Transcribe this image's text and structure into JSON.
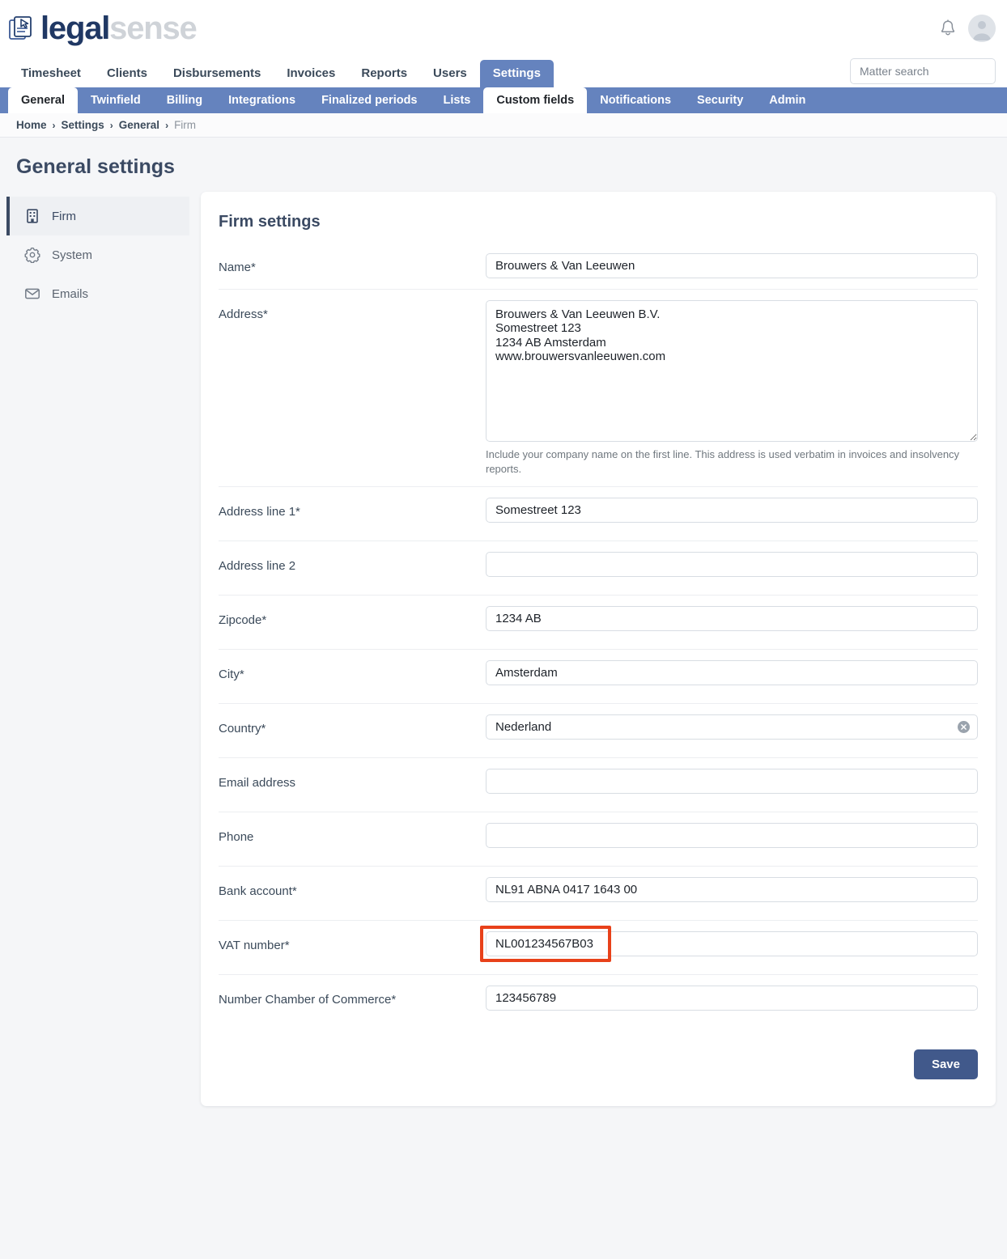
{
  "brand": {
    "logo_primary": "legal",
    "logo_secondary": "sense",
    "color_navy": "#203864",
    "color_gray": "#cfd3d8",
    "nav_blue": "#6583be",
    "accent_red": "#e8411a",
    "save_blue": "#41598b"
  },
  "header": {
    "bell_icon": "bell-icon",
    "avatar_icon": "avatar"
  },
  "search": {
    "placeholder": "Matter search",
    "value": ""
  },
  "top_nav": {
    "items": [
      {
        "label": "Timesheet",
        "active": false
      },
      {
        "label": "Clients",
        "active": false
      },
      {
        "label": "Disbursements",
        "active": false
      },
      {
        "label": "Invoices",
        "active": false
      },
      {
        "label": "Reports",
        "active": false
      },
      {
        "label": "Users",
        "active": false
      },
      {
        "label": "Settings",
        "active": true
      }
    ]
  },
  "sub_nav": {
    "items": [
      {
        "label": "General",
        "active": true
      },
      {
        "label": "Twinfield",
        "active": false
      },
      {
        "label": "Billing",
        "active": false
      },
      {
        "label": "Integrations",
        "active": false
      },
      {
        "label": "Finalized periods",
        "active": false
      },
      {
        "label": "Lists",
        "active": false
      },
      {
        "label": "Custom fields",
        "active": true
      },
      {
        "label": "Notifications",
        "active": false
      },
      {
        "label": "Security",
        "active": false
      },
      {
        "label": "Admin",
        "active": false
      }
    ]
  },
  "breadcrumb": {
    "items": [
      "Home",
      "Settings",
      "General",
      "Firm"
    ],
    "separator": "›"
  },
  "page": {
    "title": "General settings"
  },
  "sidebar": {
    "items": [
      {
        "label": "Firm",
        "icon": "building-icon",
        "active": true
      },
      {
        "label": "System",
        "icon": "gear-icon",
        "active": false
      },
      {
        "label": "Emails",
        "icon": "envelope-icon",
        "active": false
      }
    ]
  },
  "form": {
    "title": "Firm settings",
    "fields": {
      "name": {
        "label": "Name*",
        "value": "Brouwers & Van Leeuwen",
        "placeholder": ""
      },
      "address": {
        "label": "Address*",
        "value": "Brouwers & Van Leeuwen B.V.\nSomestreet 123\n1234 AB Amsterdam\nwww.brouwersvanleeuwen.com",
        "help": "Include your company name on the first line. This address is used verbatim in invoices and insolvency reports."
      },
      "address_line_1": {
        "label": "Address line 1*",
        "value": "Somestreet 123",
        "placeholder": ""
      },
      "address_line_2": {
        "label": "Address line 2",
        "value": "",
        "placeholder": ""
      },
      "zipcode": {
        "label": "Zipcode*",
        "value": "1234 AB",
        "placeholder": ""
      },
      "city": {
        "label": "City*",
        "value": "Amsterdam",
        "placeholder": ""
      },
      "country": {
        "label": "Country*",
        "value": "Nederland",
        "placeholder": "",
        "clear_icon": "clear-circle-icon"
      },
      "email_address": {
        "label": "Email address",
        "value": "",
        "placeholder": ""
      },
      "phone": {
        "label": "Phone",
        "value": "",
        "placeholder": ""
      },
      "bank_account": {
        "label": "Bank account*",
        "value": "NL91 ABNA 0417 1643 00",
        "placeholder": ""
      },
      "vat_number": {
        "label": "VAT number*",
        "value": "NL001234567B03",
        "placeholder": "",
        "highlighted": true
      },
      "chamber_of_commerce": {
        "label": "Number Chamber of Commerce*",
        "value": "123456789",
        "placeholder": ""
      }
    },
    "save_label": "Save"
  }
}
